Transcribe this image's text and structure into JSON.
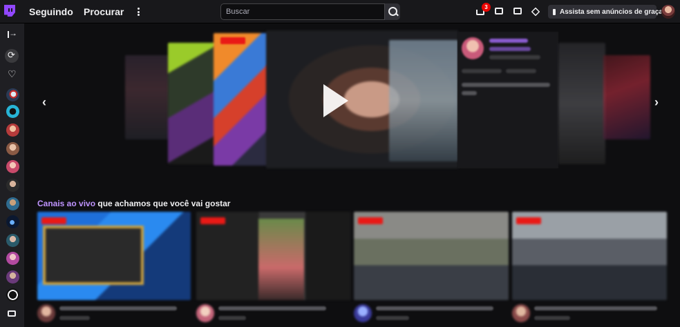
{
  "topnav": {
    "following_label": "Seguindo",
    "browse_label": "Procurar",
    "search_placeholder": "Buscar",
    "notifications_count": "3",
    "ads_button_label": "Assista sem anúncios de graça"
  },
  "section": {
    "title_accent": "Canais ao vivo",
    "title_rest": " que achamos que você vai gostar"
  },
  "colors": {
    "brand": "#9147ff",
    "accent_text": "#bf94ff",
    "live_red": "#e91916",
    "background": "#0e0e10",
    "nav_bg": "#18181b"
  }
}
